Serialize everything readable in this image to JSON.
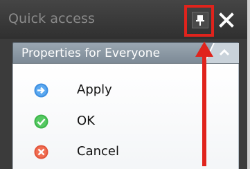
{
  "window": {
    "title": "Quick access"
  },
  "controls": {
    "pin_icon": "pin-icon",
    "close_icon": "close-icon"
  },
  "section": {
    "title": "Properties for Everyone",
    "collapse_icon": "chevron-up-icon"
  },
  "actions": [
    {
      "label": "Apply",
      "icon": "apply-icon",
      "color": "#3f8fe0"
    },
    {
      "label": "OK",
      "icon": "ok-icon",
      "color": "#3db54a"
    },
    {
      "label": "Cancel",
      "icon": "cancel-icon",
      "color": "#e2553b"
    }
  ],
  "colors": {
    "highlight": "#e0231c",
    "arrow": "#e0231c"
  }
}
